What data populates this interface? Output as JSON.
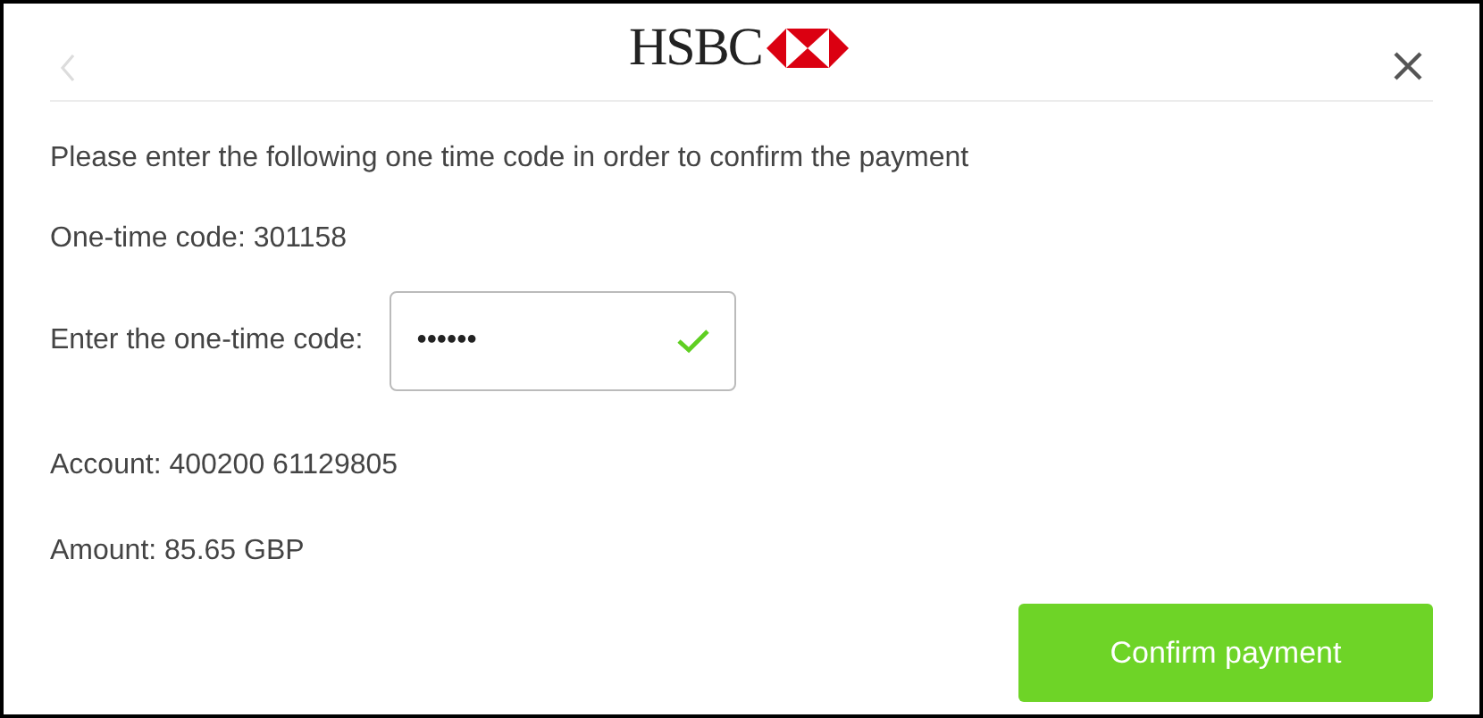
{
  "header": {
    "logo_text": "HSBC",
    "back_disabled": true
  },
  "instruction": "Please enter the following one time code in order to confirm the payment",
  "code_line": "One-time code: 301158",
  "code_field": {
    "label": "Enter the one-time code:",
    "value": "••••••",
    "valid": true
  },
  "account": "Account: 400200 61129805",
  "amount": "Amount: 85.65 GBP",
  "confirm_button": "Confirm payment"
}
